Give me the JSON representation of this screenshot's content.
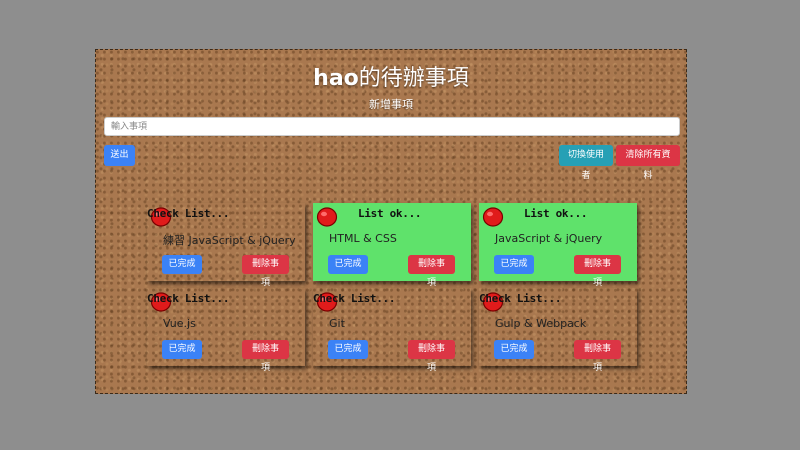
{
  "header": {
    "title_user": "hao",
    "title_rest": "的待辦事項",
    "subtitle": "新增事項"
  },
  "input": {
    "placeholder": "輸入事項",
    "value": ""
  },
  "toolbar": {
    "logout_label": "送出",
    "switch_user_label": "切換使用者",
    "clear_all_label": "清除所有資料"
  },
  "notes": [
    {
      "heading": "Check List...",
      "text": "練習 JavaScript & jQuery",
      "status": "pending",
      "done_label": "已完成",
      "delete_label": "刪除事項"
    },
    {
      "heading": "List ok...",
      "text": "HTML & CSS",
      "status": "done",
      "done_label": "已完成",
      "delete_label": "刪除事項"
    },
    {
      "heading": "List ok...",
      "text": "JavaScript & jQuery",
      "status": "done",
      "done_label": "已完成",
      "delete_label": "刪除事項"
    },
    {
      "heading": "Check List...",
      "text": "Vue.js",
      "status": "pending",
      "done_label": "已完成",
      "delete_label": "刪除事項"
    },
    {
      "heading": "Check List...",
      "text": "Git",
      "status": "pending",
      "done_label": "已完成",
      "delete_label": "刪除事項"
    },
    {
      "heading": "Check List...",
      "text": "Gulp & Webpack",
      "status": "pending",
      "done_label": "已完成",
      "delete_label": "刪除事項"
    }
  ],
  "colors": {
    "note_pending": "#fad96a",
    "note_done": "#5fe26b",
    "pin": "#e01b1b",
    "button_blue": "#3b82f6",
    "button_teal": "#26a0b5",
    "button_red": "#dc3545"
  }
}
